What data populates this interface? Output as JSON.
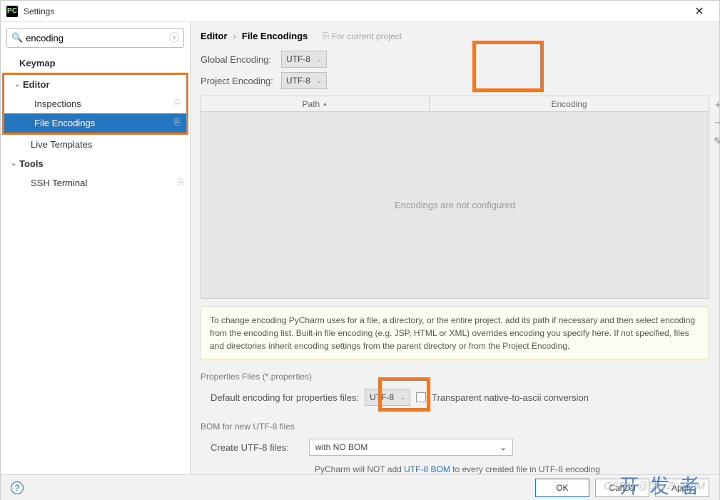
{
  "window": {
    "title": "Settings",
    "close": "✕"
  },
  "search": {
    "value": "encoding",
    "placeholder": ""
  },
  "sidebar": {
    "items": [
      {
        "label": "Keymap",
        "type": "parent",
        "chev": ""
      },
      {
        "label": "Editor",
        "type": "parent",
        "chev": "⌄",
        "highlighted": true
      },
      {
        "label": "Inspections",
        "type": "child",
        "pin": "⎘"
      },
      {
        "label": "File Encodings",
        "type": "child",
        "pin": "⎘",
        "selected": true
      },
      {
        "label": "Live Templates",
        "type": "child"
      },
      {
        "label": "Tools",
        "type": "parent",
        "chev": "⌄"
      },
      {
        "label": "SSH Terminal",
        "type": "child",
        "pin": "⎘"
      }
    ]
  },
  "breadcrumb": {
    "parent": "Editor",
    "sep": "›",
    "child": "File Encodings",
    "scope_icon": "⎘",
    "scope": "For current project"
  },
  "globalEncoding": {
    "label": "Global Encoding:",
    "value": "UTF-8"
  },
  "projectEncoding": {
    "label": "Project Encoding:",
    "value": "UTF-8"
  },
  "table": {
    "col_path": "Path",
    "col_enc": "Encoding",
    "sort": "▲",
    "empty": "Encodings are not configured",
    "tool_add": "+",
    "tool_remove": "−",
    "tool_edit": "✎"
  },
  "info": "To change encoding PyCharm uses for a file, a directory, or the entire project, add its path if necessary and then select encoding from the encoding list. Built-in file encoding (e.g. JSP, HTML or XML) overrides encoding you specify here. If not specified, files and directories inherit encoding settings from the parent directory or from the Project Encoding.",
  "propertiesSection": "Properties Files (*.properties)",
  "propDefault": {
    "label": "Default encoding for properties files:",
    "value": "UTF-8",
    "checkbox_label": "Transparent native-to-ascii conversion"
  },
  "bomSection": "BOM for new UTF-8 files",
  "bom": {
    "label": "Create UTF-8 files:",
    "value": "with NO BOM"
  },
  "bomNote": {
    "pre": "PyCharm will NOT add ",
    "link": "UTF-8 BOM",
    "post": " to every created file in UTF-8 encoding"
  },
  "buttons": {
    "ok": "OK",
    "cancel": "Cancel",
    "apply": "Apply"
  },
  "watermark": "开发者",
  "watermark2": "CSDN @DevZe.CoM"
}
